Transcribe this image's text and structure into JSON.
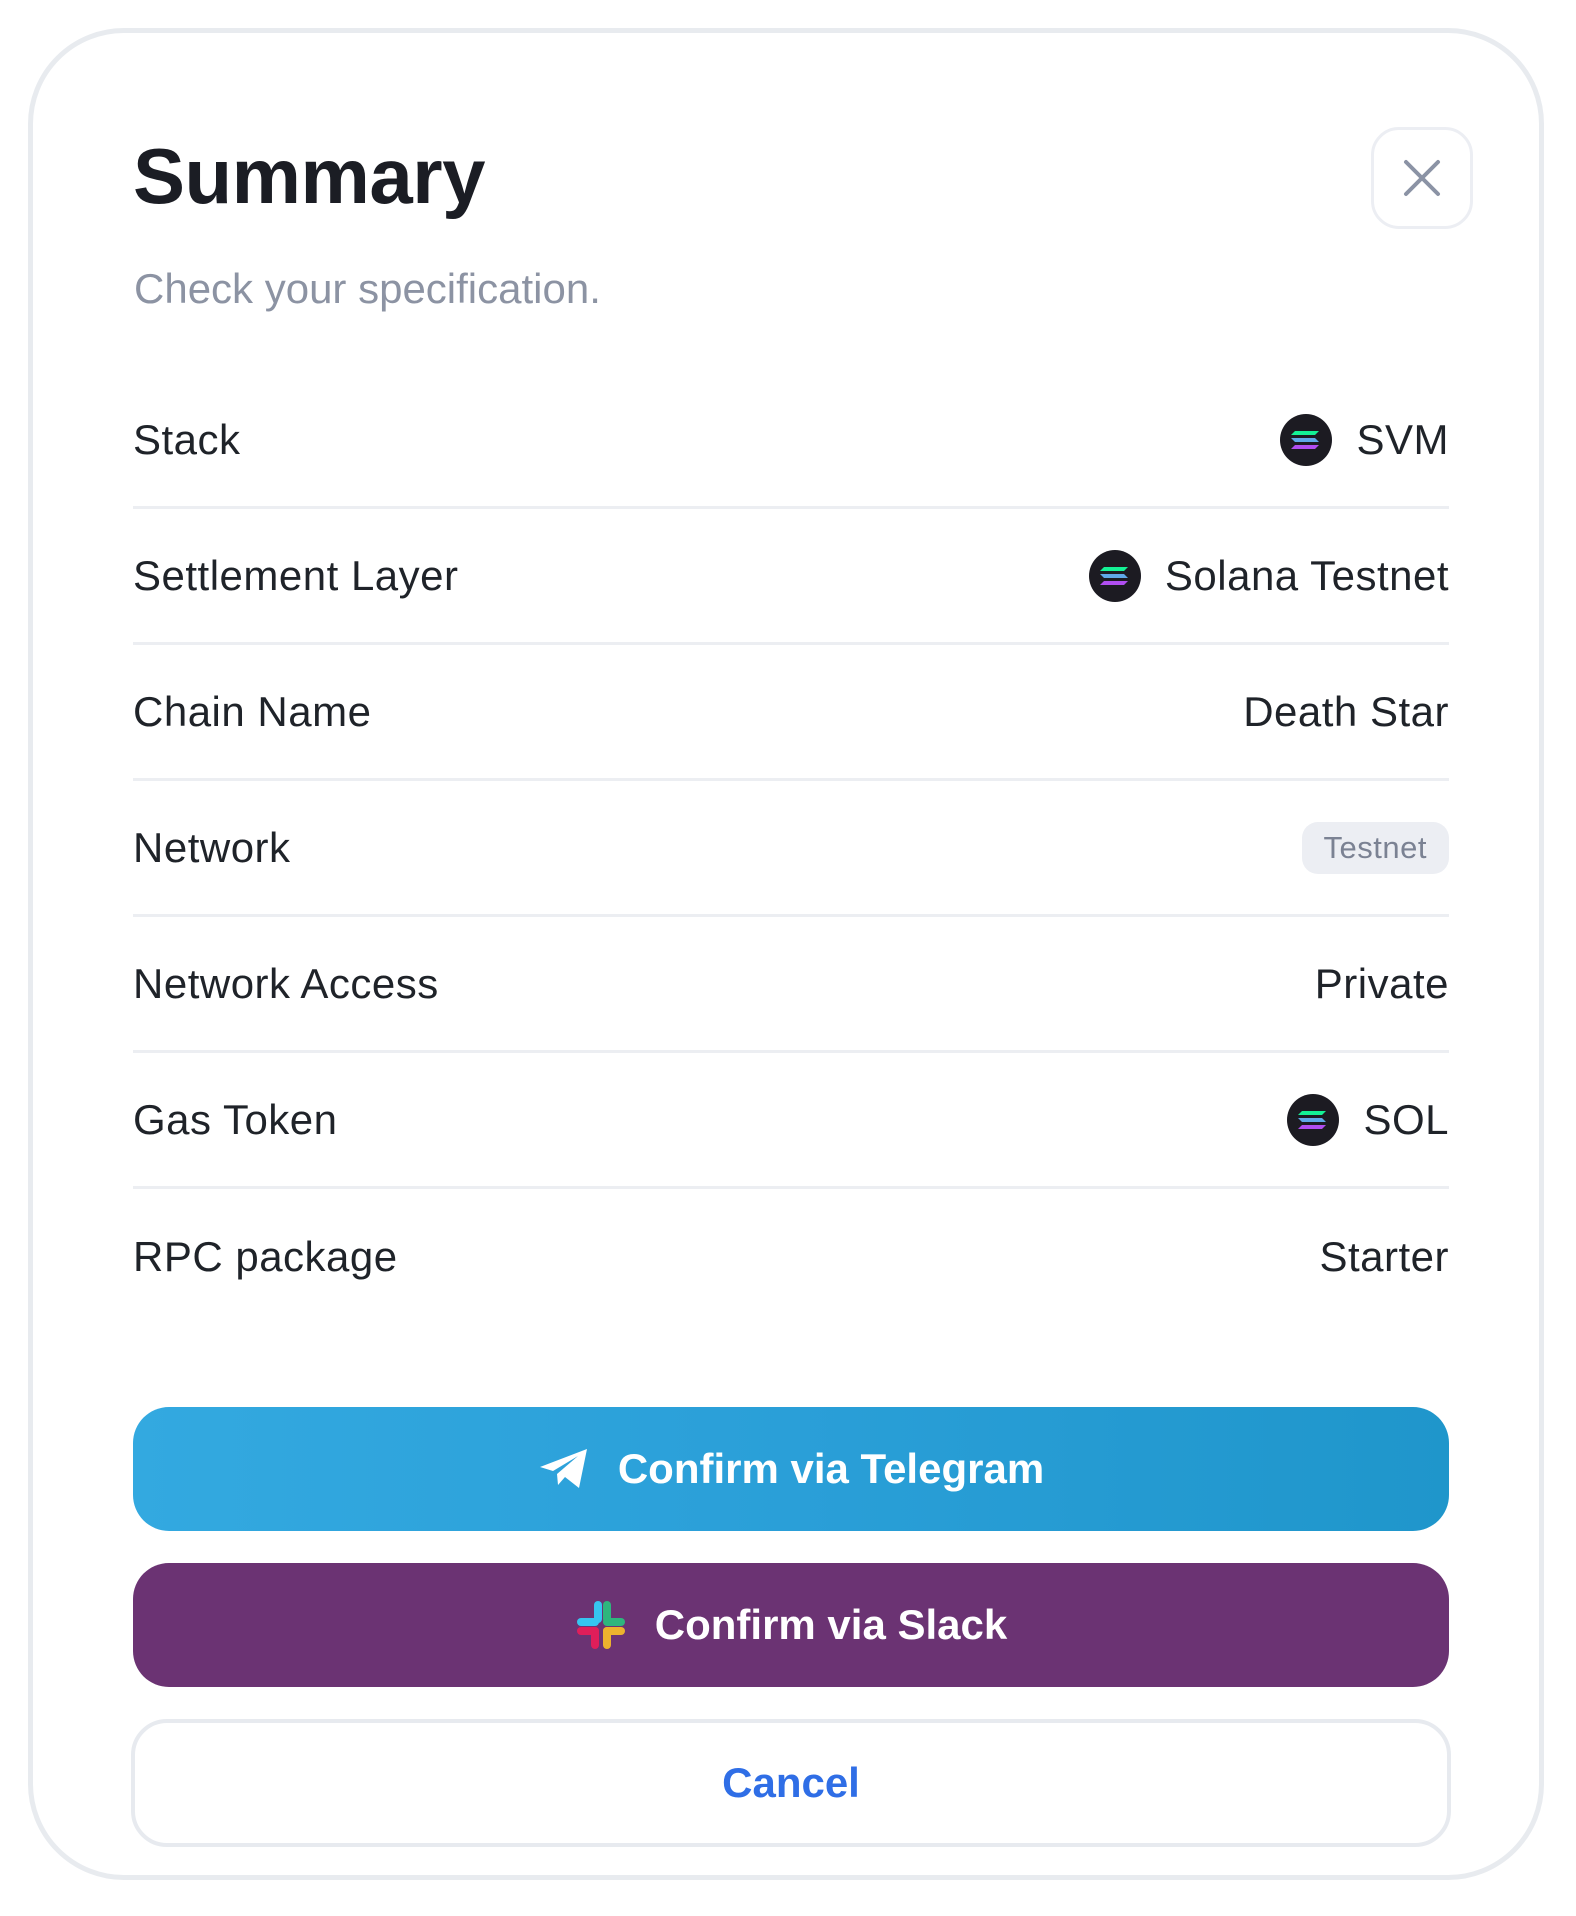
{
  "modal": {
    "title": "Summary",
    "subtitle": "Check your specification.",
    "close_icon": "close-icon"
  },
  "rows": [
    {
      "label": "Stack",
      "value": "SVM",
      "icon": "solana-icon"
    },
    {
      "label": "Settlement Layer",
      "value": "Solana Testnet",
      "icon": "solana-icon"
    },
    {
      "label": "Chain Name",
      "value": "Death Star"
    },
    {
      "label": "Network",
      "value": "Testnet",
      "style": "badge"
    },
    {
      "label": "Network Access",
      "value": "Private"
    },
    {
      "label": "Gas Token",
      "value": "SOL",
      "icon": "solana-icon"
    },
    {
      "label": "RPC package",
      "value": "Starter"
    }
  ],
  "actions": {
    "telegram": {
      "label": "Confirm via Telegram",
      "icon": "telegram-icon"
    },
    "slack": {
      "label": "Confirm via Slack",
      "icon": "slack-icon"
    },
    "cancel": {
      "label": "Cancel"
    }
  },
  "colors": {
    "telegram": "#2aa3db",
    "slack": "#6b3373",
    "cancel_text": "#2f6ee6",
    "title": "#1b1d24",
    "subtitle": "#8c93a3"
  }
}
